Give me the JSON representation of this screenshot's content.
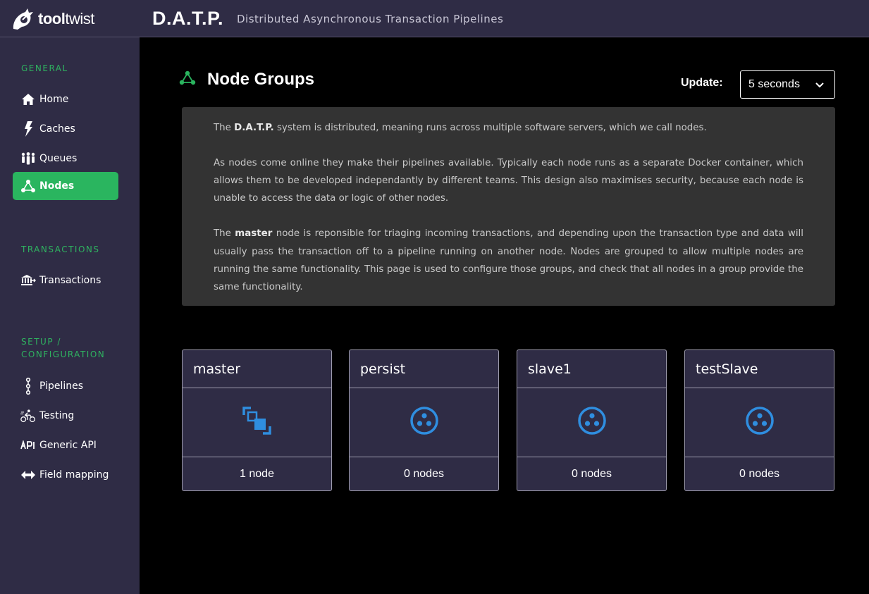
{
  "header": {
    "logo_bold": "tool",
    "logo_light": "twist",
    "app_title": "D.A.T.P.",
    "app_subtitle": "Distributed Asynchronous Transaction Pipelines"
  },
  "sidebar": {
    "sections": [
      {
        "label": "GENERAL"
      },
      {
        "label": "TRANSACTIONS"
      },
      {
        "label": "SETUP / CONFIGURATION"
      }
    ],
    "items": [
      {
        "label": "Home",
        "icon": "home-icon"
      },
      {
        "label": "Caches",
        "icon": "bolt-icon"
      },
      {
        "label": "Queues",
        "icon": "people-icon"
      },
      {
        "label": "Nodes",
        "icon": "nodes-icon",
        "active": true
      },
      {
        "label": "Transactions",
        "icon": "bank-icon"
      },
      {
        "label": "Pipelines",
        "icon": "pipeline-icon"
      },
      {
        "label": "Testing",
        "icon": "cyclist-icon"
      },
      {
        "label": "Generic API",
        "icon": "api-icon"
      },
      {
        "label": "Field mapping",
        "icon": "arrows-horizontal-icon"
      }
    ]
  },
  "main": {
    "title": "Node Groups",
    "update_label": "Update:",
    "update_value": "5 seconds",
    "description": {
      "p1_pre": "The ",
      "p1_bold": "D.A.T.P.",
      "p1_post": " system is distributed, meaning runs across multiple software servers, which we call nodes.",
      "p2": "As nodes come online they make their pipelines available. Typically each node runs as a separate Docker container, which allows them to be developed independantly by different teams. This design also maximises security, because each node is unable to access the data or logic of other nodes.",
      "p3_pre": "The ",
      "p3_bold": "master",
      "p3_post": " node is reponsible for triaging incoming transactions, and depending upon the transaction type and data will usually pass the transaction off to a pipeline running on another node. Nodes are grouped to allow multiple nodes are running the same functionality. This page is used to configure those groups, and check that all nodes in a group provide the same functionality."
    },
    "groups": [
      {
        "name": "master",
        "count": "1 node",
        "icon": "expand-nodes-icon"
      },
      {
        "name": "persist",
        "count": "0 nodes",
        "icon": "node-cluster-icon"
      },
      {
        "name": "slave1",
        "count": "0 nodes",
        "icon": "node-cluster-icon"
      },
      {
        "name": "testSlave",
        "count": "0 nodes",
        "icon": "node-cluster-icon"
      }
    ]
  },
  "colors": {
    "accent_green": "#2ab55f",
    "panel_bg": "#2f2c45",
    "icon_blue": "#2f8ee0"
  }
}
